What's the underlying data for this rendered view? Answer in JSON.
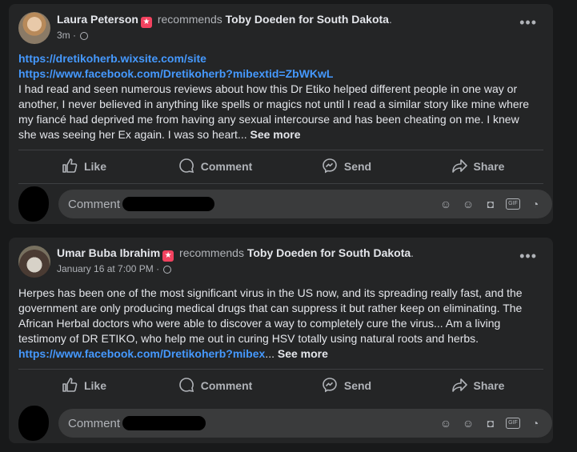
{
  "posts": [
    {
      "author": "Laura Peterson",
      "verb": "recommends",
      "target": "Toby Doeden for South Dakota",
      "period": ".",
      "time": "3m",
      "links": [
        "https://dretikoherb.wixsite.com/site",
        "https://www.facebook.com/Dretikoherb?mibextid=ZbWKwL"
      ],
      "text": "I had read and seen numerous reviews about how this Dr Etiko helped different people in one way or another, I never believed in anything like spells or magics not until I read a similar story like mine where my fiancé had deprived me from having any sexual intercourse and has been cheating on me. I knew she was seeing her Ex again. I was so heart...",
      "see_more": "See more",
      "comment_placeholder": "Comment a"
    },
    {
      "author": "Umar Buba Ibrahim",
      "verb": "recommends",
      "target": "Toby Doeden for South Dakota",
      "period": ".",
      "time": "January 16 at 7:00 PM",
      "text": "Herpes has been one of the most significant virus in the US now, and its spreading really fast, and the government are only producing medical drugs that can suppress it but rather keep on eliminating. The African Herbal doctors who were able to discover a way to completely cure the virus... Am a living testimony of DR ETIKO, who help me out in curing HSV totally using natural roots and herbs.",
      "inline_link": "https://www.facebook.com/Dretikoherb?mibex",
      "ellipsis": "...",
      "see_more": "See more",
      "comment_placeholder": "Comment"
    }
  ],
  "actions": {
    "like": "Like",
    "comment": "Comment",
    "send": "Send",
    "share": "Share"
  },
  "icons": {
    "badge": "recommendation-star-icon",
    "privacy": "globe-icon",
    "more": "more-options-icon",
    "gif_label": "GIF"
  },
  "colors": {
    "background": "#18191a",
    "card": "#242526",
    "link": "#4599ff",
    "badge": "#f3425f"
  }
}
